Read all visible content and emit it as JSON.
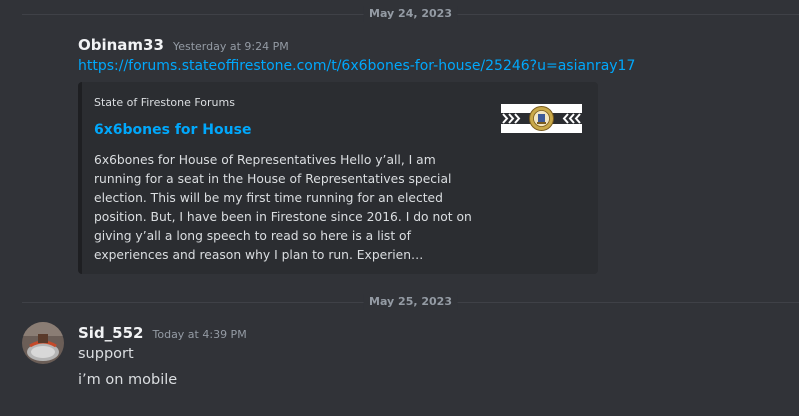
{
  "dividers": [
    "May 24, 2023",
    "May 25, 2023"
  ],
  "message1": {
    "username": "Obinam33",
    "timestamp": "Yesterday at 9:24 PM",
    "link": "https://forums.stateoffirestone.com/t/6x6bones-for-house/25246?u=asianray17",
    "embed": {
      "provider": "State of Firestone Forums",
      "title": "6x6bones for House",
      "description": "6x6bones for House of Representatives Hello y’all, I am running for a seat in the House of Representatives special election. This will be my first time running for an elected position. But, I have been in Firestone since 2016. I do not on giving y’all a long speech to read so here is a list of experiences and reason why I plan to run. Experien…",
      "thumbnail_icon": "firestone-seal-banner"
    }
  },
  "message2": {
    "username": "Sid_552",
    "timestamp": "Today at 4:39 PM",
    "avatar_icon": "user-avatar",
    "lines": [
      "support",
      "i’m on mobile"
    ]
  },
  "colors": {
    "background": "#313338",
    "embed_background": "#2b2d31",
    "link": "#00a8fc",
    "username": "#f2f3f5",
    "muted": "#949ba4"
  }
}
